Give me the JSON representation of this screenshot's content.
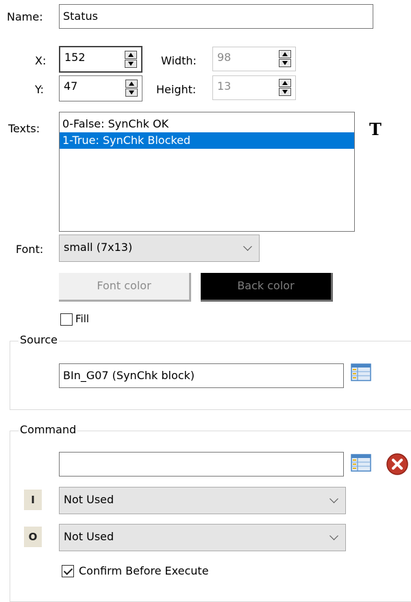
{
  "name": {
    "label": "Name:",
    "value": "Status"
  },
  "position": {
    "x_label": "X:",
    "x_value": "152",
    "y_label": "Y:",
    "y_value": "47",
    "width_label": "Width:",
    "width_value": "98",
    "height_label": "Height:",
    "height_value": "13"
  },
  "texts": {
    "label": "Texts:",
    "items": [
      "0-False: SynChk OK",
      "1-True: SynChk Blocked"
    ],
    "selected_index": 1,
    "icon": "text-T-icon",
    "icon_glyph": "T"
  },
  "font": {
    "label": "Font:",
    "value": "small (7x13)"
  },
  "buttons": {
    "font_color": "Font color",
    "back_color": "Back color"
  },
  "fill": {
    "label": "Fill",
    "checked": false
  },
  "source": {
    "title": "Source",
    "value": "BIn_G07 (SynChk block)",
    "icon": "table-browse-icon"
  },
  "command": {
    "title": "Command",
    "value": "",
    "browse_icon": "table-browse-icon",
    "clear_icon": "red-x-clear-icon",
    "i_badge": "I",
    "i_value": "Not Used",
    "o_badge": "O",
    "o_value": "Not Used",
    "confirm_label": "Confirm Before Execute",
    "confirm_checked": true
  },
  "colors": {
    "selection": "#0078d7",
    "back_color_swatch": "#000000",
    "clear_icon": "#c0392b"
  }
}
